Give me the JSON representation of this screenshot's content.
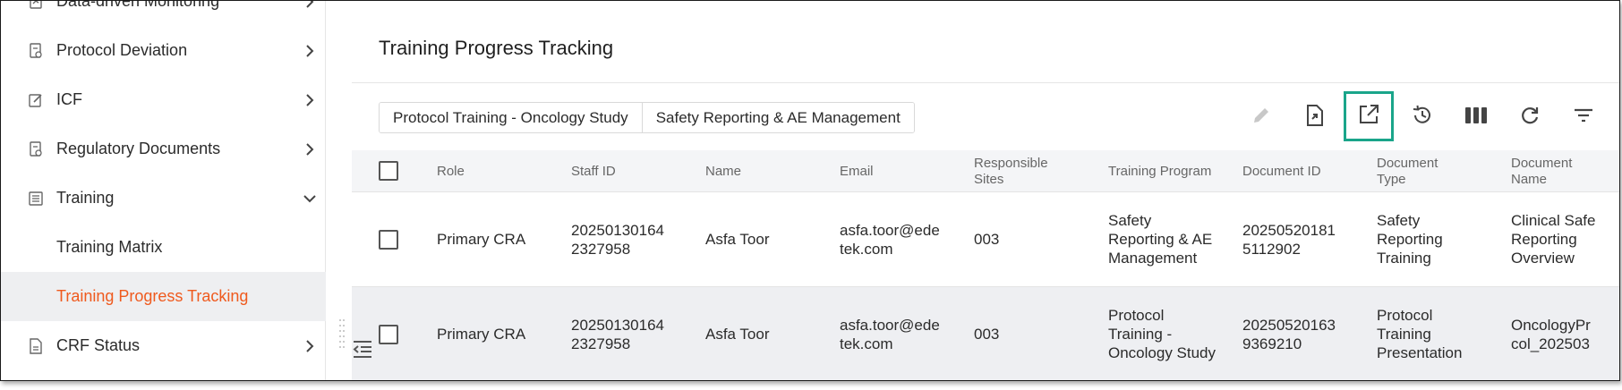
{
  "sidebar": {
    "items": [
      {
        "label": "Data-driven Monitoring",
        "icon": "monitoring-icon"
      },
      {
        "label": "Protocol Deviation",
        "icon": "document-icon"
      },
      {
        "label": "ICF",
        "icon": "edit-icon"
      },
      {
        "label": "Regulatory Documents",
        "icon": "document-icon"
      },
      {
        "label": "Training",
        "icon": "list-icon"
      },
      {
        "label": "Training Matrix"
      },
      {
        "label": "Training Progress Tracking"
      },
      {
        "label": "CRF Status",
        "icon": "file-icon"
      }
    ]
  },
  "main": {
    "title": "Training Progress Tracking",
    "tabs": [
      "Protocol Training - Oncology Study",
      "Safety Reporting & AE Management"
    ],
    "toolbar": [
      "edit-icon",
      "export-icon",
      "open-external-icon",
      "history-icon",
      "columns-icon",
      "refresh-icon",
      "filter-icon"
    ]
  },
  "table": {
    "columns": [
      "Role",
      "Staff ID",
      "Name",
      "Email",
      "Responsible Sites",
      "Training Program",
      "Document ID",
      "Document Type",
      "Document Name"
    ],
    "rows": [
      {
        "role": "Primary CRA",
        "staff_id": "20250130164 2327958",
        "name": "Asfa Toor",
        "email": "asfa.toor@ede tek.com",
        "sites": "003",
        "program": "Safety Reporting & AE Management",
        "doc_id": "20250520181 5112902",
        "doc_type": "Safety Reporting Training",
        "doc_name": "Clinical Safe Reporting Overview"
      },
      {
        "role": "Primary CRA",
        "staff_id": "20250130164 2327958",
        "name": "Asfa Toor",
        "email": "asfa.toor@ede tek.com",
        "sites": "003",
        "program": "Protocol Training - Oncology Study",
        "doc_id": "20250520163 9369210",
        "doc_type": "Protocol Training Presentation",
        "doc_name": "OncologyPr col_202503"
      }
    ]
  },
  "colors": {
    "accent": "#ef5a1e",
    "highlight": "#1aa58a",
    "active_bg": "#eeeff1"
  }
}
